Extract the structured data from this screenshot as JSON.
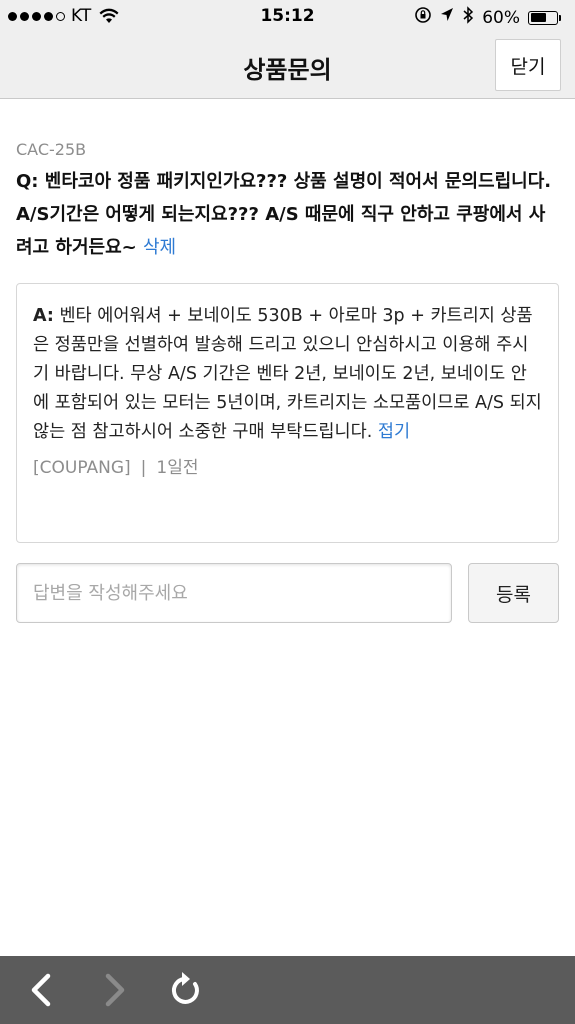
{
  "status_bar": {
    "carrier": "KT",
    "time": "15:12",
    "battery": "60%",
    "battery_level": 0.6
  },
  "nav": {
    "title": "상품문의",
    "close_label": "닫기"
  },
  "question": {
    "code": "CAC-25B",
    "prefix": "Q:",
    "text": "벤타코아 정품 패키지인가요??? 상품 설명이 적어서 문의드립니다. A/S기간은 어떻게 되는지요??? A/S 때문에 직구 안하고 쿠팡에서 사려고 하거든요~",
    "delete_label": "삭제"
  },
  "answer": {
    "prefix": "A:",
    "text": "벤타 에어워셔 + 보네이도 530B + 아로마 3p + 카트리지 상품은 정품만을 선별하여 발송해 드리고 있으니 안심하시고 이용해 주시기 바랍니다. 무상 A/S 기간은 벤타 2년, 보네이도 2년, 보네이도 안에 포함되어 있는 모터는 5년이며, 카트리지는 소모품이므로 A/S 되지 않는 점 참고하시어 소중한 구매 부탁드립니다.",
    "collapse_label": "접기",
    "author": "[COUPANG]",
    "separator": "|",
    "time": "1일전"
  },
  "reply": {
    "placeholder": "답변을 작성해주세요",
    "submit_label": "등록"
  },
  "toolbar": {
    "icons": [
      "back-arrow-icon",
      "forward-arrow-icon",
      "refresh-icon"
    ]
  }
}
